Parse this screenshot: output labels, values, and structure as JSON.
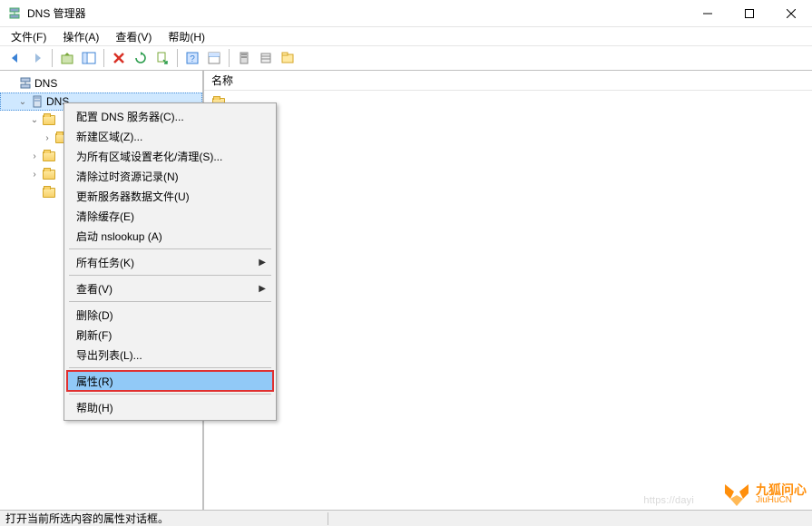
{
  "window": {
    "title": "DNS 管理器"
  },
  "menubar": {
    "file": "文件(F)",
    "action": "操作(A)",
    "view": "查看(V)",
    "help": "帮助(H)"
  },
  "tree": {
    "root": "DNS",
    "server": "DNS"
  },
  "list": {
    "header_name": "名称"
  },
  "context_menu": {
    "configure_dns": "配置 DNS 服务器(C)...",
    "new_zone": "新建区域(Z)...",
    "aging_scavenging": "为所有区域设置老化/清理(S)...",
    "scavenge_stale": "清除过时资源记录(N)",
    "update_server_data": "更新服务器数据文件(U)",
    "clear_cache": "清除缓存(E)",
    "launch_nslookup": "启动 nslookup (A)",
    "all_tasks": "所有任务(K)",
    "view": "查看(V)",
    "delete": "删除(D)",
    "refresh": "刷新(F)",
    "export_list": "导出列表(L)...",
    "properties": "属性(R)",
    "help": "帮助(H)"
  },
  "statusbar": {
    "text": "打开当前所选内容的属性对话框。"
  },
  "watermark": {
    "cn": "九狐问心",
    "en": "JiuHuCN",
    "ghost": "https://dayi"
  }
}
